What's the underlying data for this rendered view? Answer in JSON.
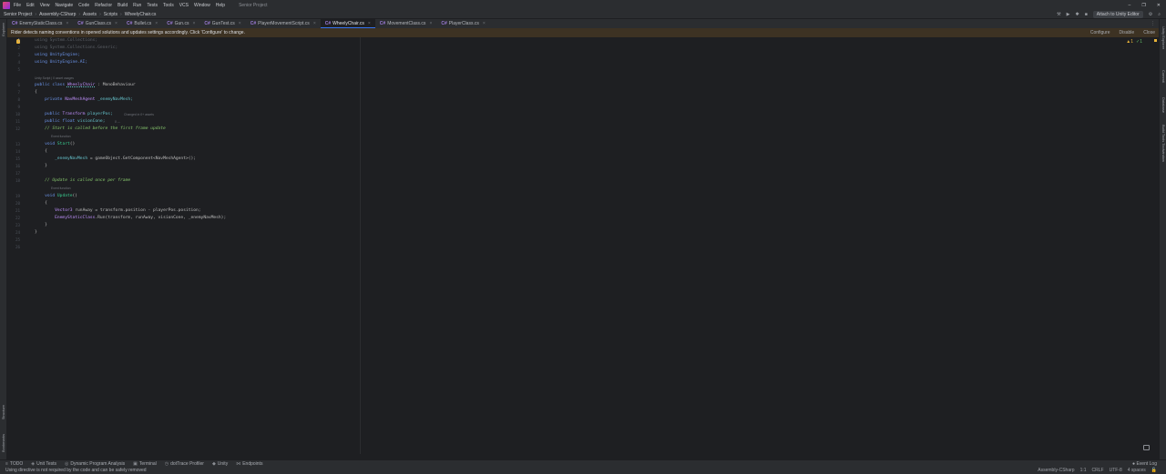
{
  "titlebar": {
    "menu": [
      "File",
      "Edit",
      "View",
      "Navigate",
      "Code",
      "Refactor",
      "Build",
      "Run",
      "Tests",
      "Tools",
      "VCS",
      "Window",
      "Help"
    ],
    "project_title": "Senior Project",
    "controls": [
      "–",
      "❐",
      "✕"
    ]
  },
  "breadcrumbs": [
    "Senior Project",
    "Assembly-CSharp",
    "Assets",
    "Scripts",
    "WheelyChair.cs"
  ],
  "nav": {
    "attach_label": "Attach to Unity Editor"
  },
  "tabs": [
    {
      "label": "EnemyStaticClass.cs",
      "active": false
    },
    {
      "label": "GunClass.cs",
      "active": false
    },
    {
      "label": "Bullet.cs",
      "active": false
    },
    {
      "label": "Gun.cs",
      "active": false
    },
    {
      "label": "GunTest.cs",
      "active": false
    },
    {
      "label": "PlayerMovementScript.cs",
      "active": false
    },
    {
      "label": "WheelyChair.cs",
      "active": true
    },
    {
      "label": "MovementClass.cs",
      "active": false
    },
    {
      "label": "PlayerClass.cs",
      "active": false
    }
  ],
  "banner": {
    "message": "Rider detects naming conventions in opened solutions and updates settings accordingly. Click 'Configure' to change.",
    "actions": [
      "Configure",
      "Disable",
      "Close"
    ]
  },
  "inspection": {
    "warnings": "▲1",
    "ok": "✓1"
  },
  "editor": {
    "line_numbers": [
      "1",
      "2",
      "3",
      "4",
      "5",
      "6",
      "7",
      "8",
      "9",
      "10",
      "11",
      "12",
      "13",
      "14",
      "15",
      "16",
      "17",
      "18",
      "19",
      "20",
      "21",
      "22",
      "23",
      "24",
      "25",
      "26"
    ],
    "lines": {
      "l1": "using System.Collections;",
      "l2": "using System.Collections.Generic;",
      "l3": "using UnityEngine;",
      "l4": "using UnityEngine.AI;",
      "h_class": "Unity Script | 0 asset usages",
      "l6_kw": "public class ",
      "l6_name": "WheelyChair",
      "l6_rest": " : MonoBehaviour",
      "l7": "{",
      "l8_kw": "    private ",
      "l8_type": "NavMeshAgent",
      "l8_field": " _enemyNavMesh;",
      "l10_kw": "    public ",
      "l10_type": "Transform ",
      "l10_field": "playerPos;",
      "h_playerpos": "Changed in 0+ assets",
      "l11_kw": "    public float ",
      "l11_field": "visionCone;",
      "l11_hint": "0 ↔",
      "l12": "    // Start is called before the first frame update",
      "h_start": "Event function",
      "l13_kw": "    void ",
      "l13_name": "Start",
      "l13_rest": "()",
      "l14": "    {",
      "l15_field": "        _enemyNavMesh",
      "l15_rest": " = gameObject.GetComponent<NavMeshAgent>();",
      "l16": "    }",
      "l18": "    // Update is called once per frame",
      "h_update": "Event function",
      "l19_kw": "    void ",
      "l19_name": "Update",
      "l19_rest": "()",
      "l20": "    {",
      "l21_type": "        Vector3",
      "l21_rest": " runAway = transform.position - playerPos.position;",
      "l22_cls": "        EnemyStaticClass",
      "l22_rest": ".Run(transform, runAway, visionCone, _enemyNavMesh);",
      "l23": "    }",
      "l24": "}"
    }
  },
  "left_strip": {
    "top_label": "Explorer",
    "bottom_labels": [
      "Structure",
      "Bookmarks"
    ]
  },
  "right_strip": {
    "labels": [
      "Unity Explorer",
      "Commit",
      "Database",
      "Build Tools Toolwindow"
    ]
  },
  "toolbar": {
    "items": [
      "TODO",
      "Unit Tests",
      "Dynamic Program Analysis",
      "Terminal",
      "dotTrace Profiler",
      "Unity",
      "Endpoints"
    ],
    "right": "Event Log"
  },
  "status": {
    "message": "Using directive is not required by the code and can be safely removed",
    "right": [
      "Assembly-CSharp",
      "1:1",
      "CRLF",
      "UTF-8",
      "4 spaces"
    ]
  },
  "colors": {
    "accent": "#3574f0",
    "banner_bg": "#3d3223",
    "editor_bg": "#1e1f22",
    "chrome_bg": "#2b2d30"
  }
}
